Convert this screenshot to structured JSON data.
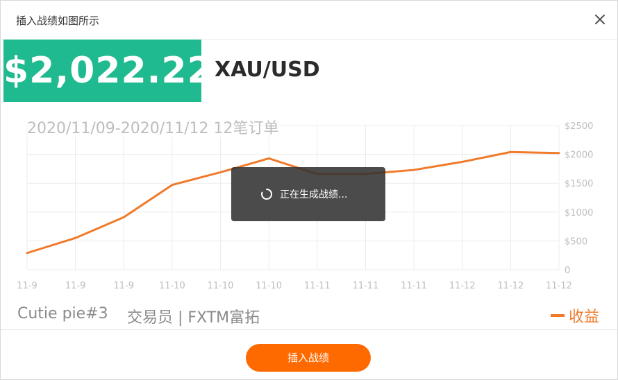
{
  "dialog": {
    "title": "插入战绩如图所示",
    "close_icon": "close-icon"
  },
  "price": "$2,022.22",
  "symbol": "XAU/USD",
  "date_range": "2020/11/09-2020/11/12 12笔订单",
  "loading": {
    "text": "正在生成战绩...",
    "icon": "spinner-icon"
  },
  "trader": {
    "name": "Cutie pie#3",
    "role": "交易员 | FXTM富拓"
  },
  "legend": {
    "label": "收益",
    "color": "#f07a2a"
  },
  "button": {
    "insert_label": "插入战绩",
    "color": "#ff6a00"
  },
  "colors": {
    "price_bg": "#1fba8f",
    "line": "#f07a2a",
    "grid": "#ececec",
    "tick": "#bdbdbd"
  },
  "chart_data": {
    "type": "line",
    "categories": [
      "11-9",
      "11-9",
      "11-9",
      "11-10",
      "11-10",
      "11-10",
      "11-11",
      "11-11",
      "11-11",
      "11-12",
      "11-12",
      "11-12"
    ],
    "series": [
      {
        "name": "收益",
        "values": [
          290,
          550,
          910,
          1470,
          1690,
          1930,
          1660,
          1660,
          1730,
          1870,
          2040,
          2022.22
        ]
      }
    ],
    "ylim": [
      0,
      2500
    ],
    "yticks": [
      0,
      500,
      1000,
      1500,
      2000,
      2500
    ],
    "ytick_labels": [
      "0",
      "$500",
      "$1000",
      "$1500",
      "$2000",
      "$2500"
    ],
    "y_axis_position": "right",
    "grid": true,
    "legend": "bottom-right",
    "title": "",
    "xlabel": "",
    "ylabel": ""
  }
}
